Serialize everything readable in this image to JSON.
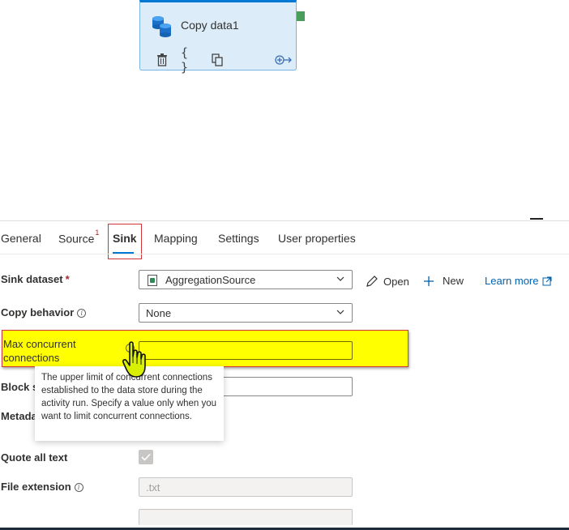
{
  "canvas": {
    "activity": {
      "name": "Copy data1"
    }
  },
  "tabs": [
    {
      "label": "General"
    },
    {
      "label": "Source",
      "badge": "1"
    },
    {
      "label": "Sink"
    },
    {
      "label": "Mapping"
    },
    {
      "label": "Settings"
    },
    {
      "label": "User properties"
    }
  ],
  "form": {
    "sink_dataset": {
      "label": "Sink dataset",
      "required_mark": "*",
      "value": "AggregationSource",
      "open_label": "Open",
      "new_label": "New",
      "learn_more_label": "Learn more"
    },
    "copy_behavior": {
      "label": "Copy behavior",
      "value": "None"
    },
    "max_concurrent": {
      "label_line1": "Max concurrent",
      "label_line2": "connections",
      "value": ""
    },
    "block_size": {
      "label_partial": "Block si"
    },
    "metadata": {
      "label_partial": "Metada"
    },
    "quote_all_text": {
      "label": "Quote all text",
      "checked": true
    },
    "file_extension": {
      "label": "File extension",
      "value": ".txt"
    }
  },
  "tooltip": {
    "text": "The upper limit of concurrent connections established to the data store during the activity run. Specify a value only when you want to limit concurrent connections."
  },
  "colors": {
    "accent": "#0078d4",
    "highlight": "#ffff00",
    "highlight_border": "#d13438",
    "link": "#0062ad"
  }
}
